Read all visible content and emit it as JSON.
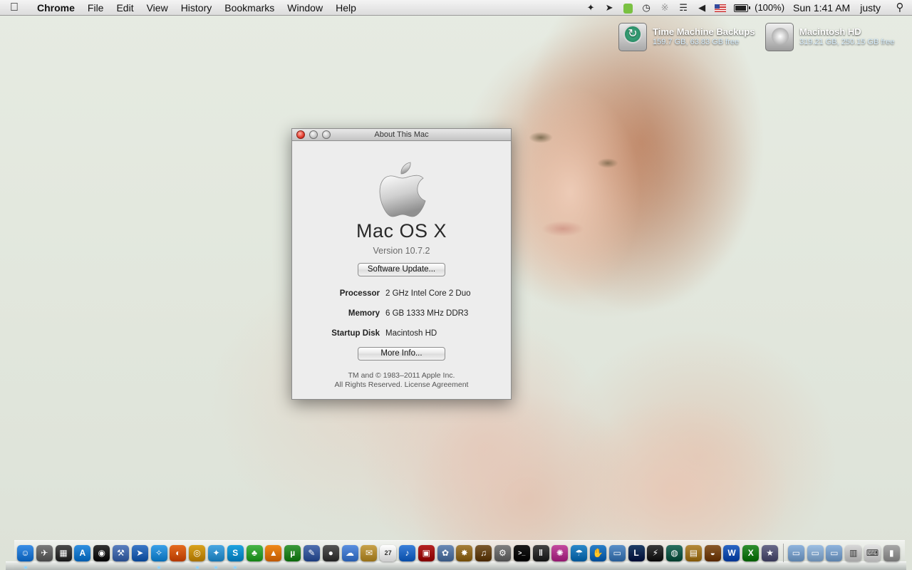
{
  "menubar": {
    "app_name": "Chrome",
    "menus": [
      "File",
      "Edit",
      "View",
      "History",
      "Bookmarks",
      "Window",
      "Help"
    ],
    "status": {
      "battery_percent_label": "(100%)",
      "battery_level": 1.0,
      "clock": "Sun 1:41 AM",
      "user": "justy"
    }
  },
  "desktop": {
    "drives": [
      {
        "name": "Time Machine Backups",
        "info": "159.7 GB, 63.83 GB free"
      },
      {
        "name": "Macintosh HD",
        "info": "319.21 GB, 250.15 GB free"
      }
    ]
  },
  "about_window": {
    "title": "About This Mac",
    "os_name": "Mac OS X",
    "version": "Version 10.7.2",
    "software_update_label": "Software Update...",
    "specs": {
      "processor": {
        "label": "Processor",
        "value": "2 GHz Intel Core 2 Duo"
      },
      "memory": {
        "label": "Memory",
        "value": "6 GB 1333 MHz DDR3"
      },
      "startup_disk": {
        "label": "Startup Disk",
        "value": "Macintosh HD"
      }
    },
    "more_info_label": "More Info...",
    "legal_line1": "TM and © 1983–2011 Apple Inc.",
    "legal_line2": "All Rights Reserved.  License Agreement"
  },
  "dock": {
    "apps": [
      {
        "name": "finder-icon",
        "color": "#3a8ee6",
        "glyph": "☺"
      },
      {
        "name": "launchpad-icon",
        "color": "#7a7a7a",
        "glyph": "✈"
      },
      {
        "name": "dashboard-icon",
        "color": "#4a4a4a",
        "glyph": "▦"
      },
      {
        "name": "app-store-icon",
        "color": "#2f8fe0",
        "glyph": "A"
      },
      {
        "name": "dashboard-gauge-icon",
        "color": "#333333",
        "glyph": "◉"
      },
      {
        "name": "xcode-icon",
        "color": "#5a7fbf",
        "glyph": "⚒"
      },
      {
        "name": "cursor-app-icon",
        "color": "#3b78c7",
        "glyph": "➤"
      },
      {
        "name": "safari-icon",
        "color": "#3aa0e8",
        "glyph": "✧"
      },
      {
        "name": "firefox-icon",
        "color": "#e56b1f",
        "glyph": "◐"
      },
      {
        "name": "chrome-icon",
        "color": "#d9a21c",
        "glyph": "◎"
      },
      {
        "name": "twitter-icon",
        "color": "#49a7e2",
        "glyph": "✦"
      },
      {
        "name": "skype-icon",
        "color": "#1fa3e0",
        "glyph": "S"
      },
      {
        "name": "adium-icon",
        "color": "#47b547",
        "glyph": "♣"
      },
      {
        "name": "vlc-icon",
        "color": "#f08a1a",
        "glyph": "▲"
      },
      {
        "name": "utorrent-icon",
        "color": "#3c9a3c",
        "glyph": "µ"
      },
      {
        "name": "pencil-app-icon",
        "color": "#4f6fb0",
        "glyph": "✎"
      },
      {
        "name": "camera-app-icon",
        "color": "#555555",
        "glyph": "●"
      },
      {
        "name": "chat-app-icon",
        "color": "#5a8fe0",
        "glyph": "☁"
      },
      {
        "name": "notes-app-icon",
        "color": "#c8a24a",
        "glyph": "✉"
      },
      {
        "name": "calendar-icon",
        "color": "#ffffff",
        "glyph": "27"
      },
      {
        "name": "itunes-icon",
        "color": "#3a7fd9",
        "glyph": "♪"
      },
      {
        "name": "photo-booth-icon",
        "color": "#b52222",
        "glyph": "▣"
      },
      {
        "name": "iphoto-icon",
        "color": "#6a8ab5",
        "glyph": "✿"
      },
      {
        "name": "aperture-icon",
        "color": "#a57f3a",
        "glyph": "✸"
      },
      {
        "name": "garageband-icon",
        "color": "#7b5a2e",
        "glyph": "♫"
      },
      {
        "name": "system-preferences-icon",
        "color": "#808080",
        "glyph": "⚙"
      },
      {
        "name": "terminal-icon",
        "color": "#1a1a1a",
        "glyph": ">_"
      },
      {
        "name": "parallels-icon",
        "color": "#444444",
        "glyph": "‖"
      },
      {
        "name": "octopus-app-icon",
        "color": "#c44aa0",
        "glyph": "✺"
      },
      {
        "name": "weather-app-icon",
        "color": "#2a88c9",
        "glyph": "☂"
      },
      {
        "name": "hand-app-icon",
        "color": "#2b7fc8",
        "glyph": "✋"
      },
      {
        "name": "remote-desktop-icon",
        "color": "#5a8fc8",
        "glyph": "▭"
      },
      {
        "name": "league-of-legends-icon",
        "color": "#1e3e66",
        "glyph": "L"
      },
      {
        "name": "steam-icon",
        "color": "#3a3a3a",
        "glyph": "⚡"
      },
      {
        "name": "globe-app-icon",
        "color": "#2a7060",
        "glyph": "◍"
      },
      {
        "name": "archive-utility-icon",
        "color": "#b58a3a",
        "glyph": "▤"
      },
      {
        "name": "coconut-battery-icon",
        "color": "#8a5a2a",
        "glyph": "◒"
      },
      {
        "name": "word-icon",
        "color": "#2a66c4",
        "glyph": "W"
      },
      {
        "name": "excel-icon",
        "color": "#2f8f2f",
        "glyph": "X"
      },
      {
        "name": "imovie-icon",
        "color": "#6a6a8a",
        "glyph": "★"
      }
    ],
    "stacks": [
      {
        "name": "applications-folder-icon",
        "color": "#8fb4dd",
        "glyph": "▭"
      },
      {
        "name": "documents-folder-icon",
        "color": "#9dbfe3",
        "glyph": "▭"
      },
      {
        "name": "downloads-folder-icon",
        "color": "#8fb4dd",
        "glyph": "▭"
      },
      {
        "name": "printer-icon",
        "color": "#d8d8d8",
        "glyph": "▥"
      },
      {
        "name": "keyboard-icon",
        "color": "#e4e4e4",
        "glyph": "⌨"
      },
      {
        "name": "trash-icon",
        "color": "#a8a8a8",
        "glyph": "▮"
      }
    ]
  }
}
